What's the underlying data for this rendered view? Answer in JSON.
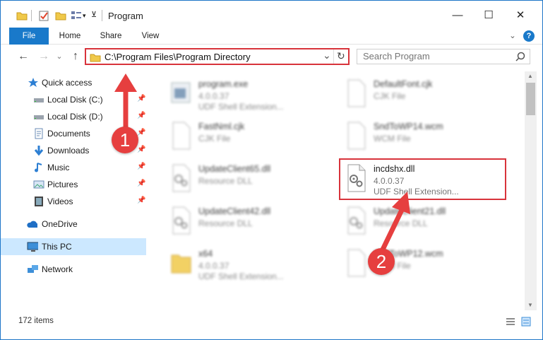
{
  "titlebar": {
    "title": "Program",
    "controls": {
      "minimize": "—",
      "maximize": "☐",
      "close": "✕"
    }
  },
  "ribbon": {
    "tabs": [
      "File",
      "Home",
      "Share",
      "View"
    ],
    "expand": "⌄",
    "help": "?"
  },
  "address_bar": {
    "path": "C:\\Program Files\\Program Directory",
    "dropdown": "⌄",
    "refresh": "↻"
  },
  "nav_buttons": {
    "back": "←",
    "forward": "→",
    "recent": "⌄",
    "up": "↑"
  },
  "search": {
    "placeholder": "Search Program"
  },
  "sidebar": {
    "items": [
      {
        "label": "Quick access",
        "icon": "star-icon",
        "pinned": false
      },
      {
        "label": "Local Disk (C:)",
        "icon": "drive-icon",
        "pinned": true
      },
      {
        "label": "Local Disk (D:)",
        "icon": "drive-icon",
        "pinned": true
      },
      {
        "label": "Documents",
        "icon": "documents-icon",
        "pinned": true
      },
      {
        "label": "Downloads",
        "icon": "download-icon",
        "pinned": true
      },
      {
        "label": "Music",
        "icon": "music-icon",
        "pinned": true
      },
      {
        "label": "Pictures",
        "icon": "pictures-icon",
        "pinned": true
      },
      {
        "label": "Videos",
        "icon": "videos-icon",
        "pinned": true
      },
      {
        "label": "OneDrive",
        "icon": "cloud-icon",
        "pinned": false
      },
      {
        "label": "This PC",
        "icon": "computer-icon",
        "pinned": false,
        "selected": true
      },
      {
        "label": "Network",
        "icon": "network-icon",
        "pinned": false
      }
    ]
  },
  "files": [
    {
      "name": "program.exe",
      "line2": "4.0.0.37",
      "line3": "UDF Shell Extension...",
      "icon": "exe-icon",
      "blurred": true
    },
    {
      "name": "DefaultFont.cjk",
      "line2": "CJK File",
      "line3": "",
      "icon": "file-icon",
      "blurred": true
    },
    {
      "name": "FastNml.cjk",
      "line2": "CJK File",
      "line3": "",
      "icon": "file-icon",
      "blurred": true
    },
    {
      "name": "SndToWP14.wcm",
      "line2": "WCM File",
      "line3": "",
      "icon": "file-icon",
      "blurred": true
    },
    {
      "name": "UpdateClient65.dll",
      "line2": "Resource DLL",
      "line3": "",
      "icon": "dll-icon",
      "blurred": true
    },
    {
      "name": "incdshx.dll",
      "line2": "4.0.0.37",
      "line3": "UDF Shell Extension...",
      "icon": "dll-icon",
      "blurred": false
    },
    {
      "name": "UpdateClient42.dll",
      "line2": "Resource DLL",
      "line3": "",
      "icon": "dll-icon",
      "blurred": true
    },
    {
      "name": "UpdateClient21.dll",
      "line2": "Resource DLL",
      "line3": "",
      "icon": "dll-icon",
      "blurred": true
    },
    {
      "name": "x64",
      "line2": "4.0.0.37",
      "line3": "UDF Shell Extension...",
      "icon": "folder-icon",
      "blurred": true
    },
    {
      "name": "SndToWP12.wcm",
      "line2": "WCM File",
      "line3": "",
      "icon": "file-icon",
      "blurred": true
    }
  ],
  "annotations": {
    "step1": "1",
    "step2": "2"
  },
  "statusbar": {
    "count": "172 items"
  },
  "colors": {
    "accent": "#1979ca",
    "highlight": "#d8333b",
    "badge": "#e63f3f"
  }
}
